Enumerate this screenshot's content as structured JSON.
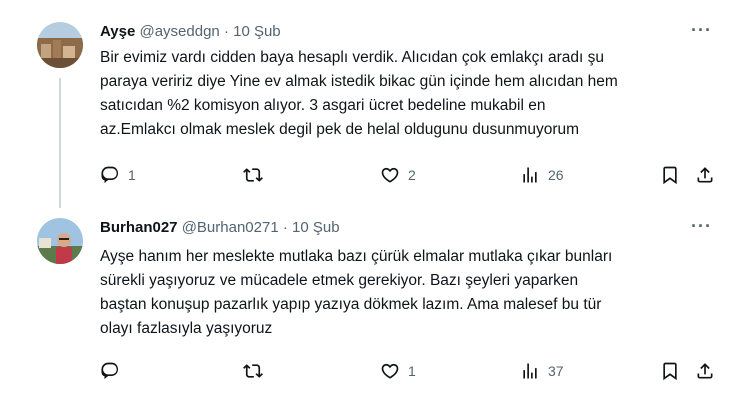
{
  "tweets": [
    {
      "name": "Ayşe",
      "handle": "@ayseddgn",
      "date": "· 10 Şub",
      "more": "···",
      "text_lines": [
        "Bir evimiz vardı cidden baya hesaplı verdik. Alıcıdan çok emlakçı aradı şu",
        "paraya veririz diye Yine ev almak istedik bikac gün içinde hem alıcıdan hem",
        "satıcıdan %2 komisyon alıyor. 3 asgari ücret bedeline mukabil en",
        "az.Emlakcı olmak meslek degil pek de helal oldugunu dusunmuyorum"
      ],
      "replies": "1",
      "retweets": "",
      "likes": "2",
      "views": "26"
    },
    {
      "name": "Burhan027",
      "handle": "@Burhan0271",
      "date": "· 10 Şub",
      "more": "···",
      "text_lines": [
        "Ayşe hanım her meslekte mutlaka bazı çürük elmalar mutlaka çıkar bunları",
        "sürekli yaşıyoruz ve mücadele etmek gerekiyor. Bazı şeyleri yaparken",
        "baştan konuşup pazarlık yapıp yazıya dökmek lazım.  Ama malesef bu tür",
        "olayı fazlasıyla yaşıyoruz"
      ],
      "replies": "",
      "retweets": "",
      "likes": "1",
      "views": "37"
    }
  ],
  "colors": {
    "text": "#0f1419",
    "muted": "#536471",
    "thread_line": "#cfd9de"
  },
  "icons": [
    "reply-icon",
    "retweet-icon",
    "like-icon",
    "views-icon",
    "bookmark-icon",
    "share-icon",
    "more-icon"
  ]
}
